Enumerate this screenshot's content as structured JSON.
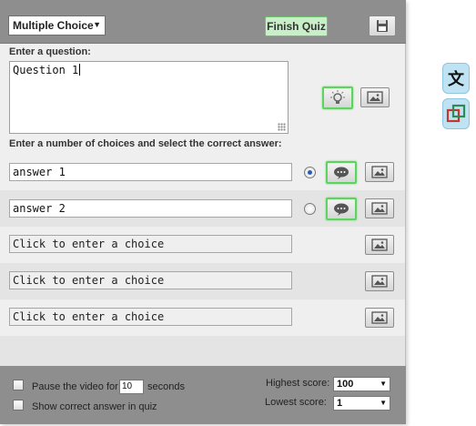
{
  "header": {
    "question_type": "Multiple Choice",
    "finish_label": "Finish Quiz",
    "save_icon": "floppy-disk-icon"
  },
  "question": {
    "label": "Enter a question:",
    "value": "Question 1",
    "hint_icon": "lightbulb-icon",
    "image_icon": "image-icon"
  },
  "choices": {
    "label": "Enter a number of choices and select the correct answer:",
    "items": [
      {
        "value": "answer 1",
        "correct": true
      },
      {
        "value": "answer 2",
        "correct": false
      },
      {
        "placeholder": "Click to enter a choice"
      },
      {
        "placeholder": "Click to enter a choice"
      },
      {
        "placeholder": "Click to enter a choice"
      }
    ],
    "feedback_icon": "speech-bubble-icon"
  },
  "footer": {
    "pause_label_before": "Pause the video for",
    "pause_value": "10",
    "pause_label_after": "seconds",
    "show_answer_label": "Show correct answer in quiz",
    "highest_label": "Highest score:",
    "highest_value": "100",
    "lowest_label": "Lowest score:",
    "lowest_value": "1"
  },
  "side_tools": {
    "translate_glyph": "文",
    "translate_icon": "translate-icon",
    "overlay_icon": "overlapping-squares-icon"
  },
  "colors": {
    "accent_green": "#5fd35f",
    "bar_gray": "#8e8e8e",
    "side_blue": "#bfe3f3"
  }
}
